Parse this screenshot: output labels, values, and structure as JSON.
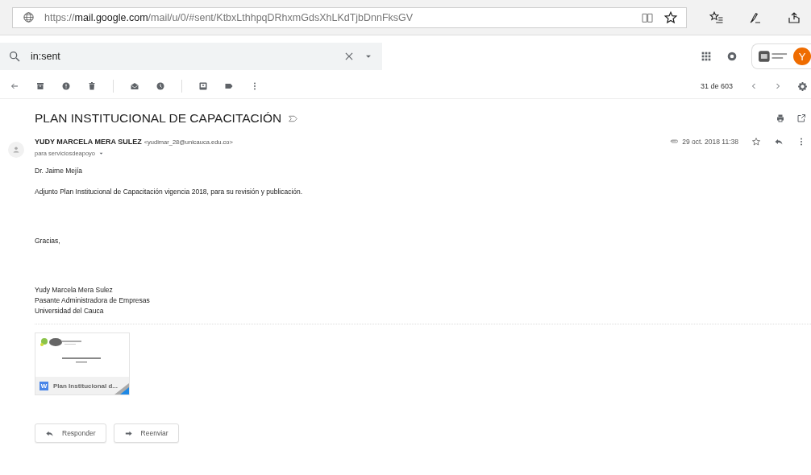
{
  "browser": {
    "url_prefix": "https://",
    "url_host": "mail.google.com",
    "url_path": "/mail/u/0/#sent/KtbxLthhpqDRhxmGdsXhLKdTjbDnnFksGV"
  },
  "search": {
    "value": "in:sent"
  },
  "account": {
    "avatar_letter": "Y"
  },
  "toolbar": {
    "pagination": "31 de 603"
  },
  "message": {
    "subject": "PLAN INSTITUCIONAL DE CAPACITACIÓN",
    "sender_name": "YUDY MARCELA MERA SULEZ",
    "sender_email": "<yudimar_28@unicauca.edu.co>",
    "recipient": "para serviciosdeapoyo",
    "date": "29 oct. 2018 11:38",
    "starred": false,
    "body": [
      {
        "lines": [
          "Dr. Jaime Mejía"
        ]
      },
      {
        "lines": [
          "Adjunto Plan Institucional de Capacitación vigencia 2018, para su revisión y publicación."
        ]
      },
      {
        "lines": [
          "Gracias,"
        ]
      },
      {
        "lines": [
          "Yudy Marcela Mera Sulez",
          "Pasante Administradora de Empresas",
          "Universidad del  Cauca"
        ]
      }
    ],
    "attachment": {
      "type_badge": "W",
      "name": "Plan Institucional d..."
    }
  },
  "actions": [
    {
      "label": "Responder",
      "kind": "reply"
    },
    {
      "label": "Reenviar",
      "kind": "forward"
    }
  ]
}
